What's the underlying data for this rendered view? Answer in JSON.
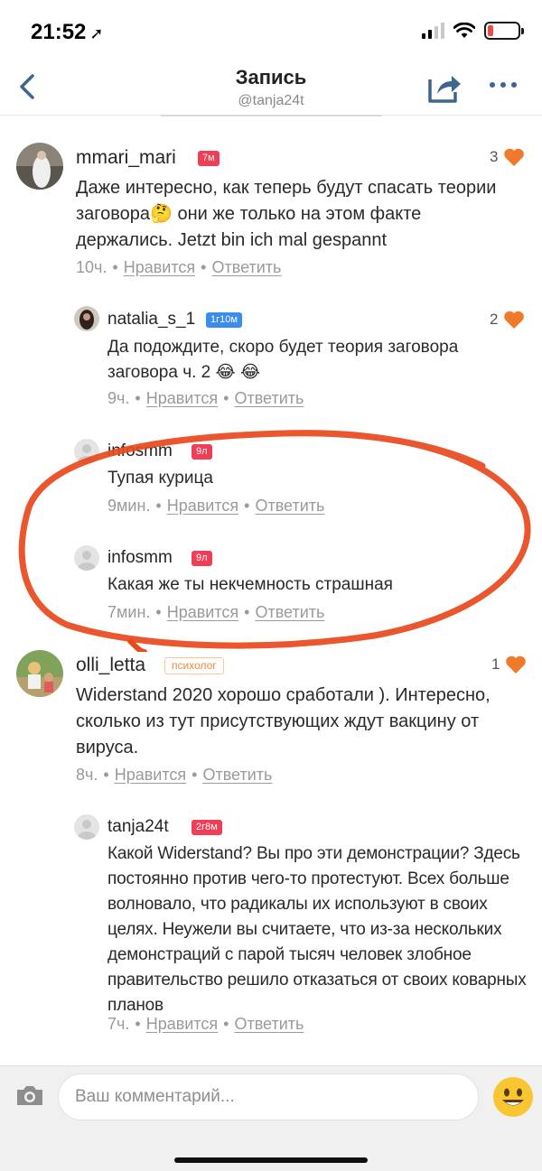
{
  "status": {
    "time": "21:52"
  },
  "nav": {
    "title": "Запись",
    "subtitle": "@tanja24t"
  },
  "comments": [
    {
      "username": "mmari_mari",
      "badge": "7м",
      "text": "Даже интересно, как теперь будут спасать теории заговора🤔 они же только на этом факте держались. Jetzt bin ich mal gespannt",
      "time": "10ч.",
      "like_label": "Нравится",
      "reply_label": "Ответить",
      "likes": "3"
    },
    {
      "username": "natalia_s_1",
      "badge": "1г10м",
      "text": "Да подождите, скоро будет теория заговора заговора ч. 2 😂 😂",
      "time": "9ч.",
      "like_label": "Нравится",
      "reply_label": "Ответить",
      "likes": "2"
    },
    {
      "username": "infosmm",
      "badge": "9л",
      "text": "Тупая курица",
      "time": "9мин.",
      "like_label": "Нравится",
      "reply_label": "Ответить"
    },
    {
      "username": "infosmm",
      "badge": "9л",
      "text": "Какая же ты некчемность страшная",
      "time": "7мин.",
      "like_label": "Нравится",
      "reply_label": "Ответить"
    },
    {
      "username": "olli_letta",
      "badge": "психолог",
      "text": "Widerstand 2020 хорошо сработали ). Интересно, сколько из тут присутствующих ждут вакцину от вируса.",
      "time": "8ч.",
      "like_label": "Нравится",
      "reply_label": "Ответить",
      "likes": "1"
    },
    {
      "username": "tanja24t",
      "badge": "2г8м",
      "text": "Какой Widerstand? Вы про эти демонстрации? Здесь постоянно против чего-то протестуют. Всех больше волновало, что радикалы их используют в своих целях. Неужели вы считаете, что из-за нескольких демонстраций с парой тысяч человек злобное правительство решило отказаться от своих коварных планов",
      "time": "7ч.",
      "like_label": "Нравится",
      "reply_label": "Ответить"
    }
  ],
  "input": {
    "placeholder": "Ваш комментарий..."
  },
  "colors": {
    "heart": "#f07a2c",
    "badge_red": "#ef3e55",
    "badge_blue": "#3a8de8",
    "role_badge": "#f08a3c",
    "highlight_ring": "#e8481c"
  },
  "icons": [
    "back-arrow-icon",
    "share-icon",
    "more-icon",
    "heart-icon",
    "camera-icon",
    "emoji-icon"
  ]
}
